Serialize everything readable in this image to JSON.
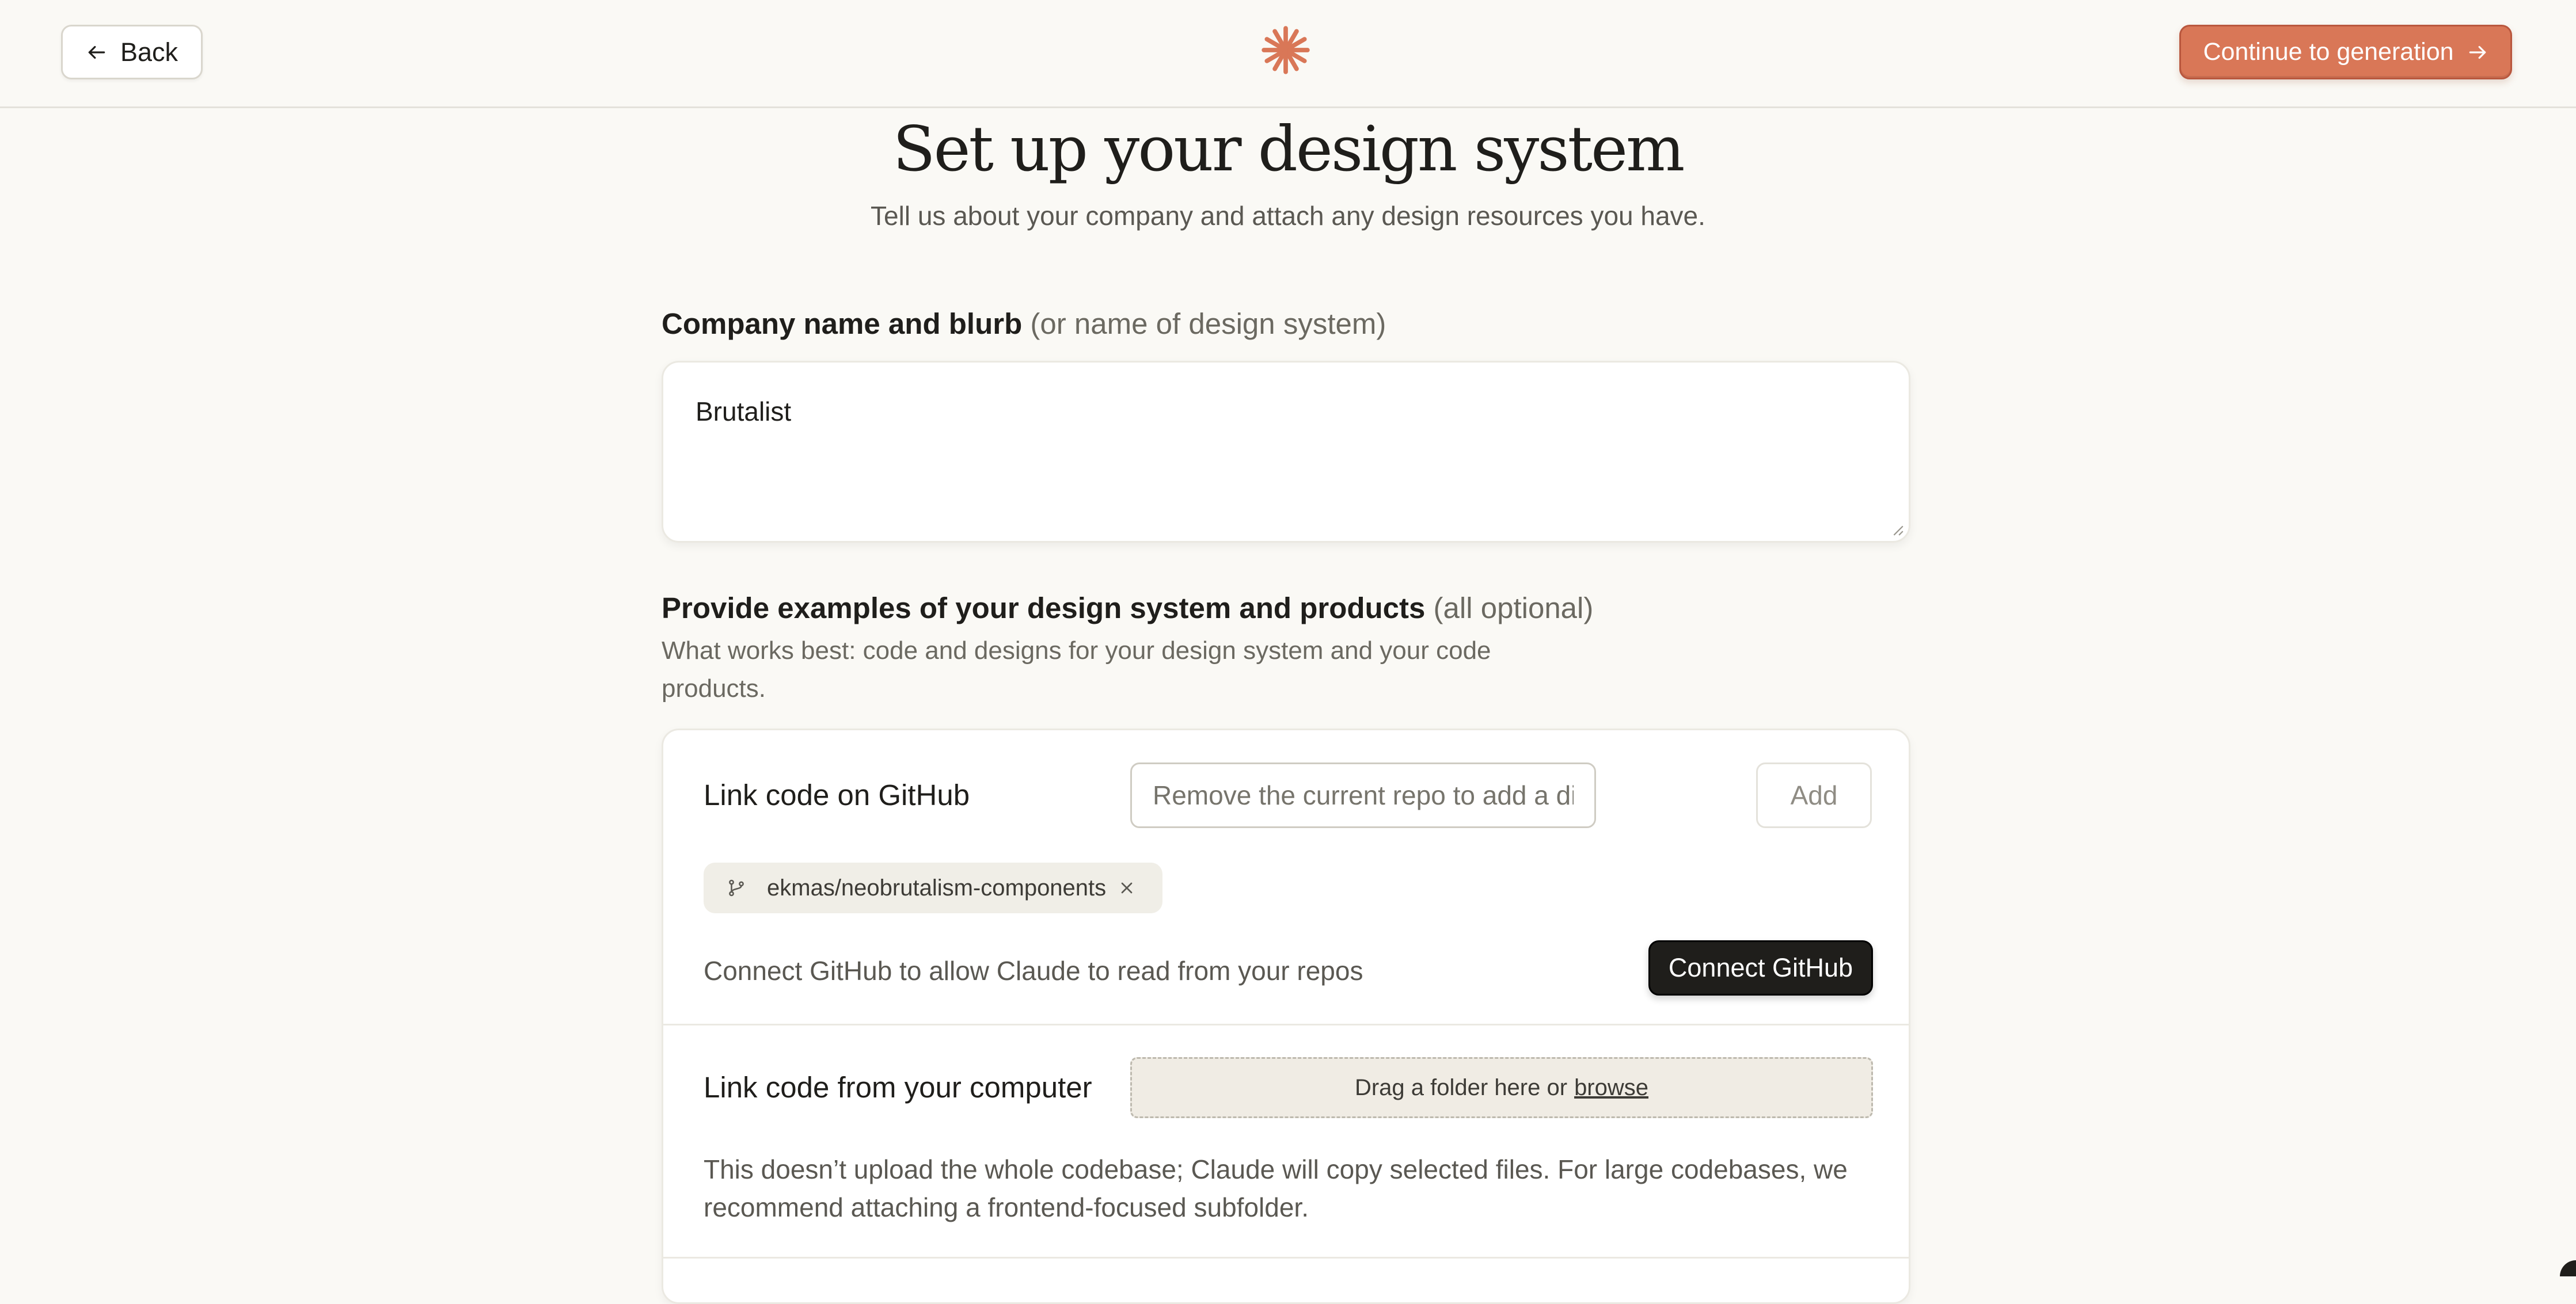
{
  "header": {
    "back_label": "Back",
    "continue_label": "Continue to generation",
    "accent_color": "#d97757"
  },
  "page": {
    "title": "Set up your design system",
    "subtitle": "Tell us about your company and attach any design resources you have."
  },
  "company": {
    "label_strong": "Company name and blurb",
    "label_muted": "(or name of design system)",
    "value": "Brutalist"
  },
  "examples": {
    "label_strong": "Provide examples of your design system and products",
    "label_muted": "(all optional)",
    "helper": "What works best: code and designs for your design system and your code products."
  },
  "github": {
    "title": "Link code on GitHub",
    "input_placeholder": "Remove the current repo to add a different one",
    "add_label": "Add",
    "repo_name": "ekmas/neobrutalism-components",
    "connect_text": "Connect GitHub to allow Claude to read from your repos",
    "connect_button": "Connect GitHub"
  },
  "local": {
    "title": "Link code from your computer",
    "drop_text": "Drag a folder here or",
    "browse_label": "browse",
    "note": "This doesn’t upload the whole codebase; Claude will copy selected files. For large codebases, we recommend attaching a frontend-focused subfolder."
  }
}
